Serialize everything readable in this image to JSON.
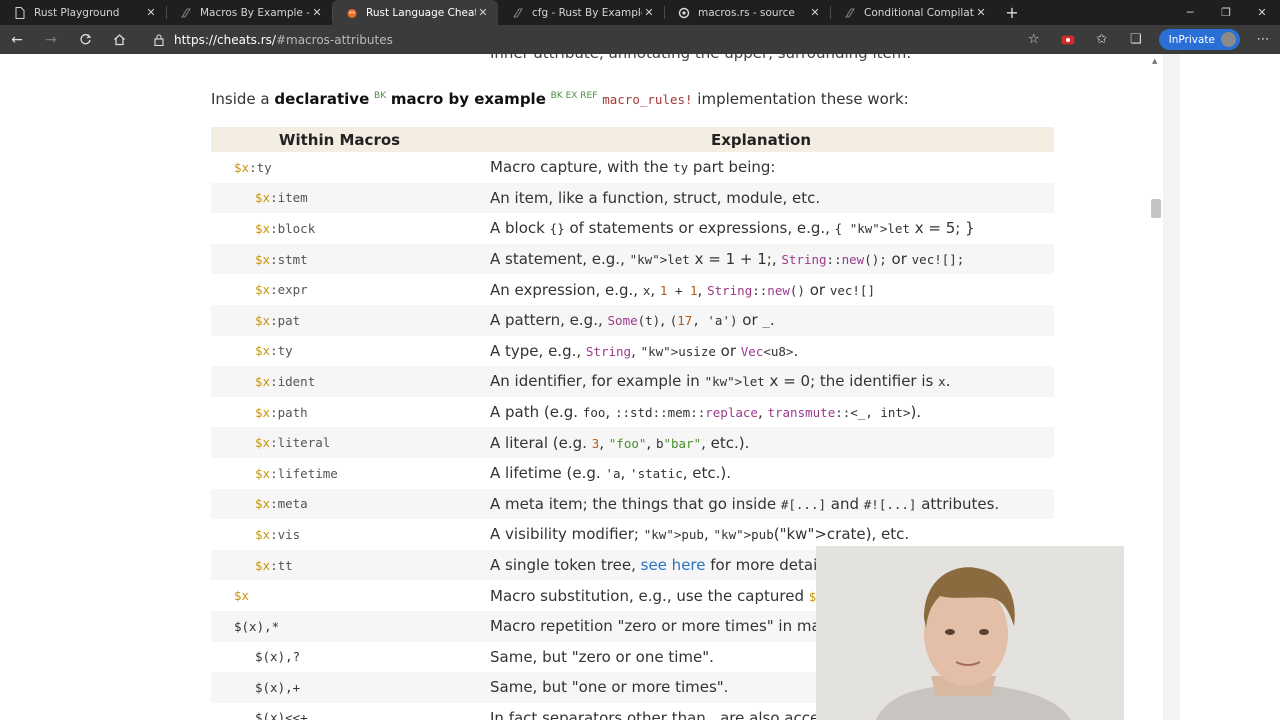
{
  "browser": {
    "tabs": [
      {
        "title": "Rust Playground",
        "icon": "document-icon",
        "active": false
      },
      {
        "title": "Macros By Example - The Ru",
        "icon": "book-icon",
        "active": false
      },
      {
        "title": "Rust Language Cheat Sheet",
        "icon": "rust-crab-icon",
        "active": true
      },
      {
        "title": "cfg - Rust By Example",
        "icon": "book-icon",
        "active": false
      },
      {
        "title": "macros.rs - source",
        "icon": "rust-gear-icon",
        "active": false
      },
      {
        "title": "Conditional Compilation - T",
        "icon": "book-icon",
        "active": false
      }
    ],
    "address": {
      "host": "https://cheats.rs/",
      "path": "#macros-attributes"
    },
    "inprivate_label": "InPrivate"
  },
  "page": {
    "cut_text": "Inner attribute, annotating the upper, surrounding item.",
    "intro": {
      "prefix": "Inside a ",
      "bold1": "declarative",
      "sup1": "BK",
      "bold2": "macro by example",
      "sup2": "BK EX REF",
      "code": "macro_rules!",
      "suffix": " implementation these work:"
    },
    "table": {
      "headers": [
        "Within Macros",
        "Explanation"
      ],
      "rows": [
        {
          "left": "$x:ty",
          "right": "Macro capture, with the ty part being:"
        },
        {
          "left": "$x:item",
          "right": "An item, like a function, struct, module, etc."
        },
        {
          "left": "$x:block",
          "right": "A block {} of statements or expressions, e.g., { let x = 5; }"
        },
        {
          "left": "$x:stmt",
          "right": "A statement, e.g., let x = 1 + 1;, String::new(); or vec![];"
        },
        {
          "left": "$x:expr",
          "right": "An expression, e.g., x, 1 + 1, String::new() or vec![]"
        },
        {
          "left": "$x:pat",
          "right": "A pattern, e.g., Some(t), (17, 'a') or _."
        },
        {
          "left": "$x:ty",
          "right": "A type, e.g., String, usize or Vec<u8>."
        },
        {
          "left": "$x:ident",
          "right": "An identifier, for example in let x = 0; the identifier is x."
        },
        {
          "left": "$x:path",
          "right": "A path (e.g. foo, ::std::mem::replace, transmute::<_, int>)."
        },
        {
          "left": "$x:literal",
          "right": "A literal (e.g. 3, \"foo\", b\"bar\", etc.)."
        },
        {
          "left": "$x:lifetime",
          "right": "A lifetime (e.g. 'a, 'static, etc.)."
        },
        {
          "left": "$x:meta",
          "right": "A meta item; the things that go inside #[...] and #![...] attributes."
        },
        {
          "left": "$x:vis",
          "right": "A visibility modifier; pub, pub(crate), etc."
        },
        {
          "left": "$x:tt",
          "right": "A single token tree, see here for more details"
        },
        {
          "left": "$x",
          "right": "Macro substitution, e.g., use the captured $x"
        },
        {
          "left": "$(x),*",
          "right": "Macro repetition \"zero or more times\" in ma"
        },
        {
          "left": "$(x),?",
          "right": "Same, but \"zero or one time\"."
        },
        {
          "left": "$(x),+",
          "right": "Same, but \"one or more times\"."
        },
        {
          "left": "$(x)<<+",
          "right": "In fact separators other than , are also acce"
        }
      ]
    }
  }
}
